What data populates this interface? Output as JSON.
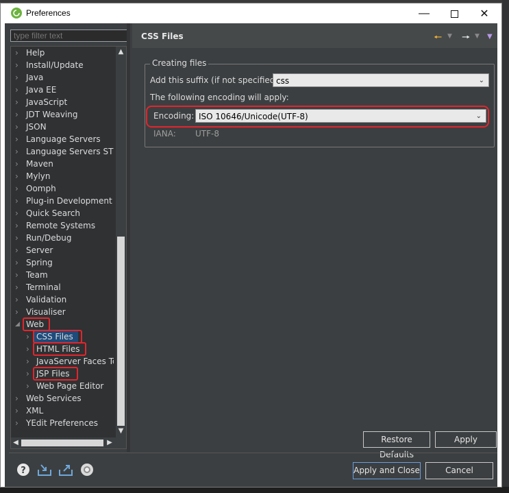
{
  "window": {
    "title": "Preferences"
  },
  "filter": {
    "placeholder": "type filter text"
  },
  "tree": {
    "items": [
      "Help",
      "Install/Update",
      "Java",
      "Java EE",
      "JavaScript",
      "JDT Weaving",
      "JSON",
      "Language Servers",
      "Language Servers STS",
      "Maven",
      "Mylyn",
      "Oomph",
      "Plug-in Development",
      "Quick Search",
      "Remote Systems",
      "Run/Debug",
      "Server",
      "Spring",
      "Team",
      "Terminal",
      "Validation",
      "Visualiser",
      "Web"
    ],
    "web_children": [
      "CSS Files",
      "HTML Files",
      "JavaServer Faces Tools",
      "JSP Files",
      "Web Page Editor"
    ],
    "items_after": [
      "Web Services",
      "XML",
      "YEdit Preferences"
    ]
  },
  "page": {
    "title": "CSS Files",
    "group_label": "Creating files",
    "suffix_label": "Add this suffix (if not specified):",
    "suffix_value": "css",
    "encoding_intro": "The following encoding will apply:",
    "encoding_label": "Encoding:",
    "encoding_value": "ISO 10646/Unicode(UTF-8)",
    "iana_label": "IANA:",
    "iana_value": "UTF-8"
  },
  "buttons": {
    "restore_defaults": "Restore Defaults",
    "apply": "Apply",
    "apply_and_close": "Apply and Close",
    "cancel": "Cancel"
  },
  "icons": {
    "help": "help-icon",
    "import": "import-icon",
    "export": "export-icon",
    "oomph": "oomph-record-icon",
    "back": "back-arrow-icon",
    "forward": "forward-arrow-icon",
    "menu": "view-menu-icon"
  },
  "colors": {
    "highlight": "#e2262d",
    "selection": "#1f4b7a",
    "back_arrow": "#f2b233"
  }
}
